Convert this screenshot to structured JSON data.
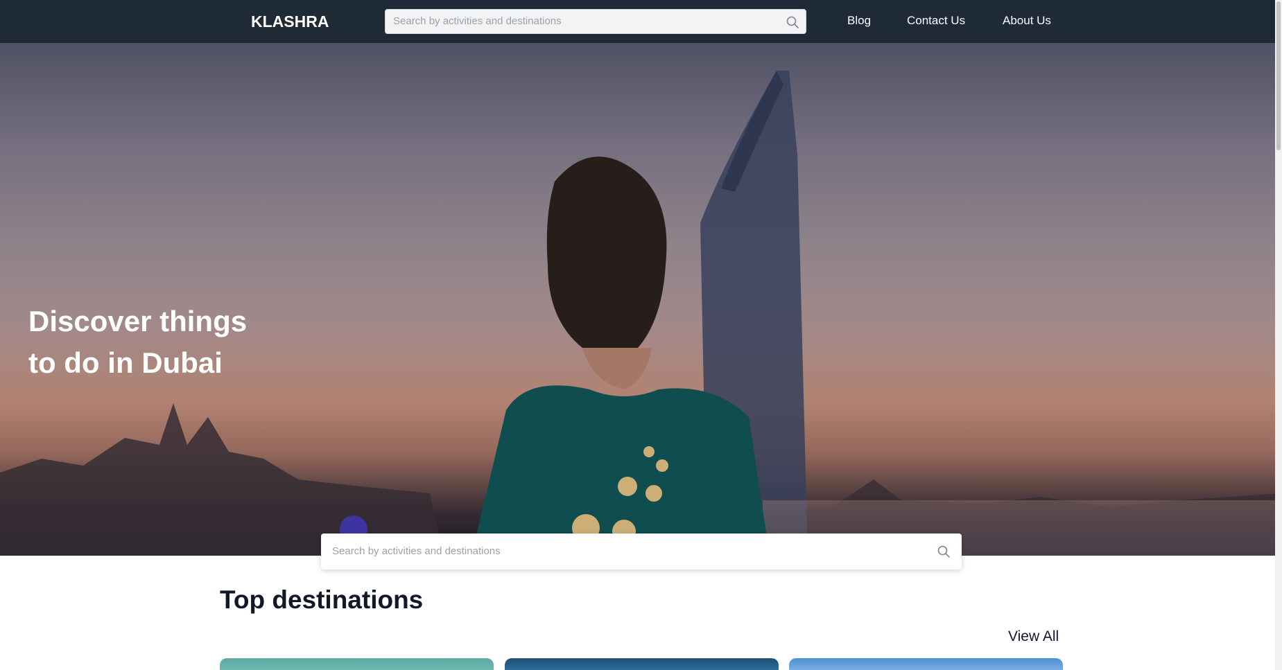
{
  "navbar": {
    "logo": "KLASHRA",
    "search_placeholder": "Search by activities and destinations",
    "links": [
      "Blog",
      "Contact Us",
      "About Us"
    ]
  },
  "hero": {
    "title": "Discover things\nto do in Dubai",
    "search_placeholder": "Search by activities and destinations"
  },
  "destinations": {
    "title": "Top destinations",
    "view_all": "View All"
  },
  "icons": {
    "nav_search": "search-icon",
    "hero_search": "search-icon"
  },
  "colors": {
    "navbar_bg": "#1f2a37",
    "heading_text": "#111827",
    "placeholder_text": "#9aa1aa"
  }
}
